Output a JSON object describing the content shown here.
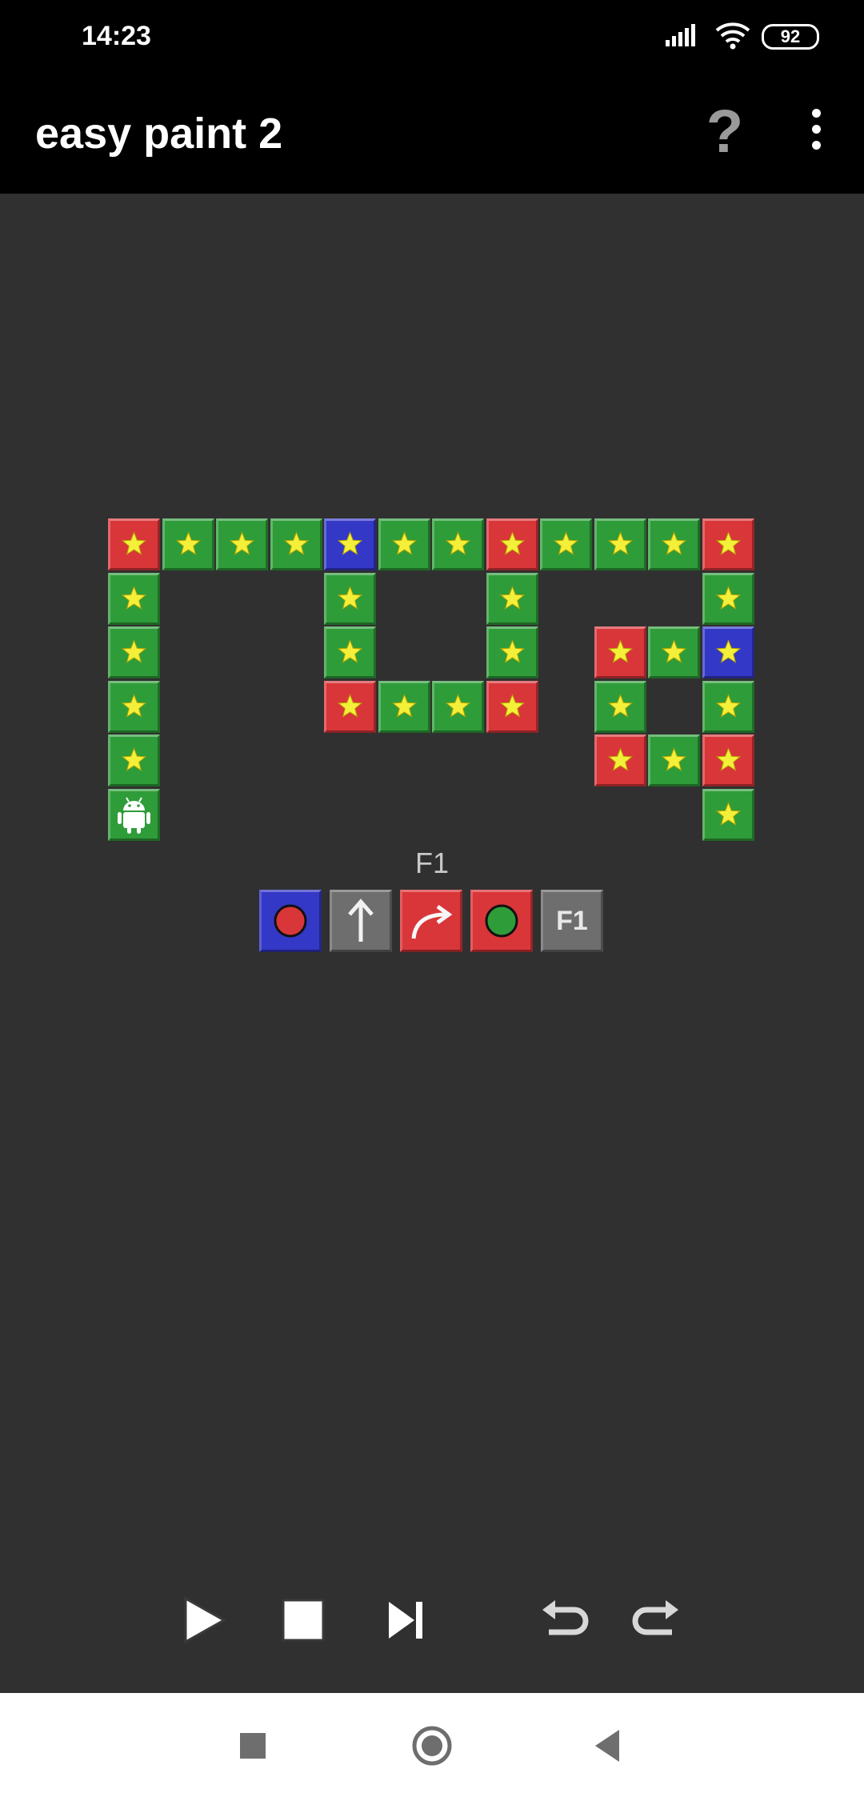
{
  "status_bar": {
    "time": "14:23",
    "battery_level": "92"
  },
  "app_bar": {
    "title": "easy paint 2",
    "help_label": "?"
  },
  "colors": {
    "green": "#2f9c3a",
    "red": "#d9363a",
    "blue": "#3438c6",
    "background": "#303030",
    "star": "#f4f03a"
  },
  "board": {
    "columns": 12,
    "rows": 6,
    "cells": [
      {
        "col": 0,
        "row": 0,
        "color": "red",
        "mark": "star"
      },
      {
        "col": 1,
        "row": 0,
        "color": "green",
        "mark": "star"
      },
      {
        "col": 2,
        "row": 0,
        "color": "green",
        "mark": "star"
      },
      {
        "col": 3,
        "row": 0,
        "color": "green",
        "mark": "star"
      },
      {
        "col": 4,
        "row": 0,
        "color": "blue",
        "mark": "star"
      },
      {
        "col": 5,
        "row": 0,
        "color": "green",
        "mark": "star"
      },
      {
        "col": 6,
        "row": 0,
        "color": "green",
        "mark": "star"
      },
      {
        "col": 7,
        "row": 0,
        "color": "red",
        "mark": "star"
      },
      {
        "col": 8,
        "row": 0,
        "color": "green",
        "mark": "star"
      },
      {
        "col": 9,
        "row": 0,
        "color": "green",
        "mark": "star"
      },
      {
        "col": 10,
        "row": 0,
        "color": "green",
        "mark": "star"
      },
      {
        "col": 11,
        "row": 0,
        "color": "red",
        "mark": "star"
      },
      {
        "col": 0,
        "row": 1,
        "color": "green",
        "mark": "star"
      },
      {
        "col": 4,
        "row": 1,
        "color": "green",
        "mark": "star"
      },
      {
        "col": 7,
        "row": 1,
        "color": "green",
        "mark": "star"
      },
      {
        "col": 11,
        "row": 1,
        "color": "green",
        "mark": "star"
      },
      {
        "col": 0,
        "row": 2,
        "color": "green",
        "mark": "star"
      },
      {
        "col": 4,
        "row": 2,
        "color": "green",
        "mark": "star"
      },
      {
        "col": 7,
        "row": 2,
        "color": "green",
        "mark": "star"
      },
      {
        "col": 9,
        "row": 2,
        "color": "red",
        "mark": "star"
      },
      {
        "col": 10,
        "row": 2,
        "color": "green",
        "mark": "star"
      },
      {
        "col": 11,
        "row": 2,
        "color": "blue",
        "mark": "star"
      },
      {
        "col": 0,
        "row": 3,
        "color": "green",
        "mark": "star"
      },
      {
        "col": 4,
        "row": 3,
        "color": "red",
        "mark": "star"
      },
      {
        "col": 5,
        "row": 3,
        "color": "green",
        "mark": "star"
      },
      {
        "col": 6,
        "row": 3,
        "color": "green",
        "mark": "star"
      },
      {
        "col": 7,
        "row": 3,
        "color": "red",
        "mark": "star"
      },
      {
        "col": 9,
        "row": 3,
        "color": "green",
        "mark": "star"
      },
      {
        "col": 11,
        "row": 3,
        "color": "green",
        "mark": "star"
      },
      {
        "col": 0,
        "row": 4,
        "color": "green",
        "mark": "star"
      },
      {
        "col": 9,
        "row": 4,
        "color": "red",
        "mark": "star"
      },
      {
        "col": 10,
        "row": 4,
        "color": "green",
        "mark": "star"
      },
      {
        "col": 11,
        "row": 4,
        "color": "red",
        "mark": "star"
      },
      {
        "col": 0,
        "row": 5,
        "color": "green",
        "mark": "robot"
      },
      {
        "col": 11,
        "row": 5,
        "color": "green",
        "mark": "star"
      }
    ]
  },
  "program": {
    "label": "F1",
    "commands": [
      {
        "type": "paint-red",
        "bg": "#3438c6",
        "icon": "red-circle-icon"
      },
      {
        "type": "forward",
        "bg": "#6e6e6e",
        "icon": "up-arrow-icon"
      },
      {
        "type": "turn-right",
        "bg": "#d9363a",
        "icon": "turn-right-arrow-icon"
      },
      {
        "type": "paint-green",
        "bg": "#d9363a",
        "icon": "green-circle-icon"
      },
      {
        "type": "call-f1",
        "bg": "#6e6e6e",
        "icon": "f1-call-icon",
        "label": "F1"
      }
    ]
  },
  "controls": [
    "play-icon",
    "stop-icon",
    "step-icon",
    "undo-icon",
    "redo-icon"
  ],
  "navigation": [
    "recents-icon",
    "home-icon",
    "back-icon"
  ]
}
